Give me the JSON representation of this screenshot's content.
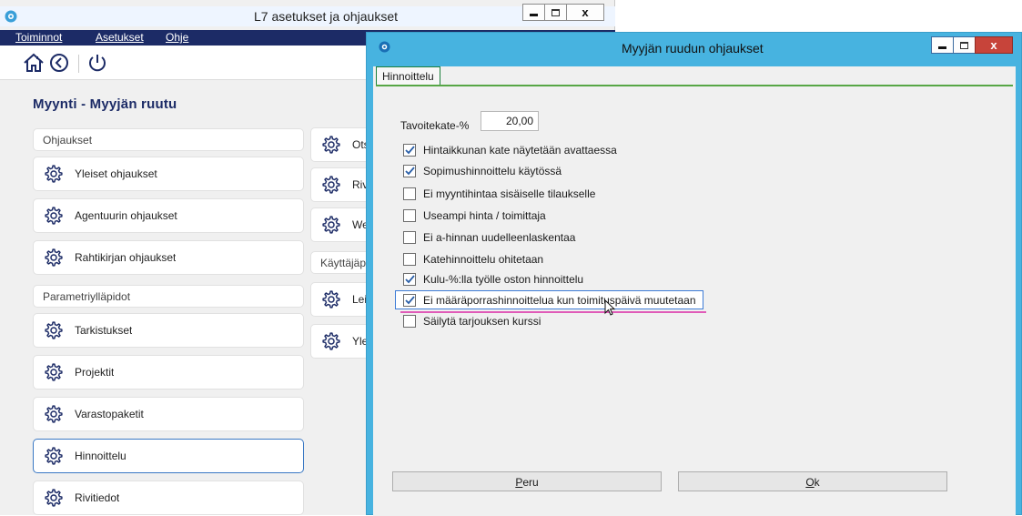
{
  "main_window": {
    "title": "L7 asetukset ja ohjaukset",
    "menu": [
      "Toiminnot",
      "Asetukset",
      "Ohje"
    ],
    "section_title": "Myynti - Myyjän ruutu",
    "left_column": {
      "header_ohjaukset": "Ohjaukset",
      "yleiset": "Yleiset ohjaukset",
      "agentuurin": "Agentuurin ohjaukset",
      "rahtikirjan": "Rahtikirjan ohjaukset",
      "header_parametri": "Parametriylläpidot",
      "tarkistukset": "Tarkistukset",
      "projektit": "Projektit",
      "varastopaketit": "Varastopaketit",
      "hinnoittelu": "Hinnoittelu",
      "rivitiedot": "Rivitiedot"
    },
    "right_column": {
      "otsi": "Otsi",
      "rivi": "Rivi",
      "web": "Web",
      "header_kayttaja": "Käyttäjäpa",
      "leik": "Leik",
      "yleis": "Yleis"
    }
  },
  "dialog": {
    "title": "Myyjän ruudun ohjaukset",
    "tab_label": "Hinnoittelu",
    "tavoitekate_label": "Tavoitekate-%",
    "tavoitekate_value": "20,00",
    "checkboxes": [
      {
        "label": "Hintaikkunan kate näytetään avattaessa",
        "checked": true
      },
      {
        "label": "Sopimushinnoittelu käytössä",
        "checked": true
      },
      {
        "label": "Ei myyntihintaa sisäiselle tilaukselle",
        "checked": false
      },
      {
        "label": "Useampi hinta / toimittaja",
        "checked": false
      },
      {
        "label": "Ei a-hinnan uudelleenlaskentaa",
        "checked": false
      },
      {
        "label": "Katehinnoittelu ohitetaan",
        "checked": false
      },
      {
        "label": "Kulu-%:lla työlle oston hinnoittelu",
        "checked": true
      },
      {
        "label": "Ei määräporrashinnoittelua kun toimituspäivä muutetaan",
        "checked": true
      },
      {
        "label": "Säilytä tarjouksen kurssi",
        "checked": false
      }
    ],
    "cancel_label": "Peru",
    "ok_label": "Ok"
  },
  "colors": {
    "menubar": "#1c2b66",
    "dialog_frame": "#47b3e0",
    "section_title": "#1c2b66",
    "tab_border": "#57a646",
    "highlight_underline": "#e05bb8"
  }
}
